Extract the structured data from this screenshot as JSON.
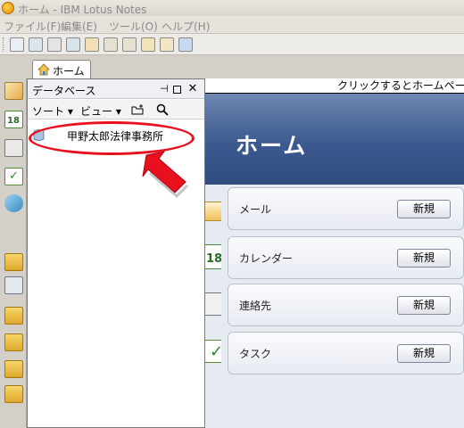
{
  "window": {
    "title": "ホーム - IBM Lotus Notes"
  },
  "menu": [
    "ファイル(F)",
    "編集(E)",
    "ツール(O)",
    "ヘルプ(H)"
  ],
  "tabs": {
    "home_label": "ホーム"
  },
  "hint_text": "クリックするとホームページ",
  "home": {
    "title": "ホーム",
    "items": [
      {
        "label": "メール",
        "button": "新規"
      },
      {
        "label": "カレンダー",
        "button": "新規"
      },
      {
        "label": "連絡先",
        "button": "新規"
      },
      {
        "label": "タスク",
        "button": "新規"
      }
    ]
  },
  "databases_panel": {
    "title": "データベース",
    "sort_label": "ソート ▾",
    "view_label": "ビュー ▾",
    "entries": [
      {
        "label": "甲野太郎法律事務所"
      }
    ]
  },
  "colors": {
    "highlight": "#e8101c",
    "hero": "#3c5a8f",
    "arrow": "#e8101c"
  },
  "icons": [
    "app-logo-icon",
    "home-icon",
    "calendar-icon",
    "contacts-icon",
    "todo-icon",
    "replicator-icon",
    "folder-icon",
    "pin-icon",
    "restore-icon",
    "close-icon",
    "new-folder-icon",
    "search-icon",
    "database-icon",
    "arrow-pointer-icon"
  ]
}
